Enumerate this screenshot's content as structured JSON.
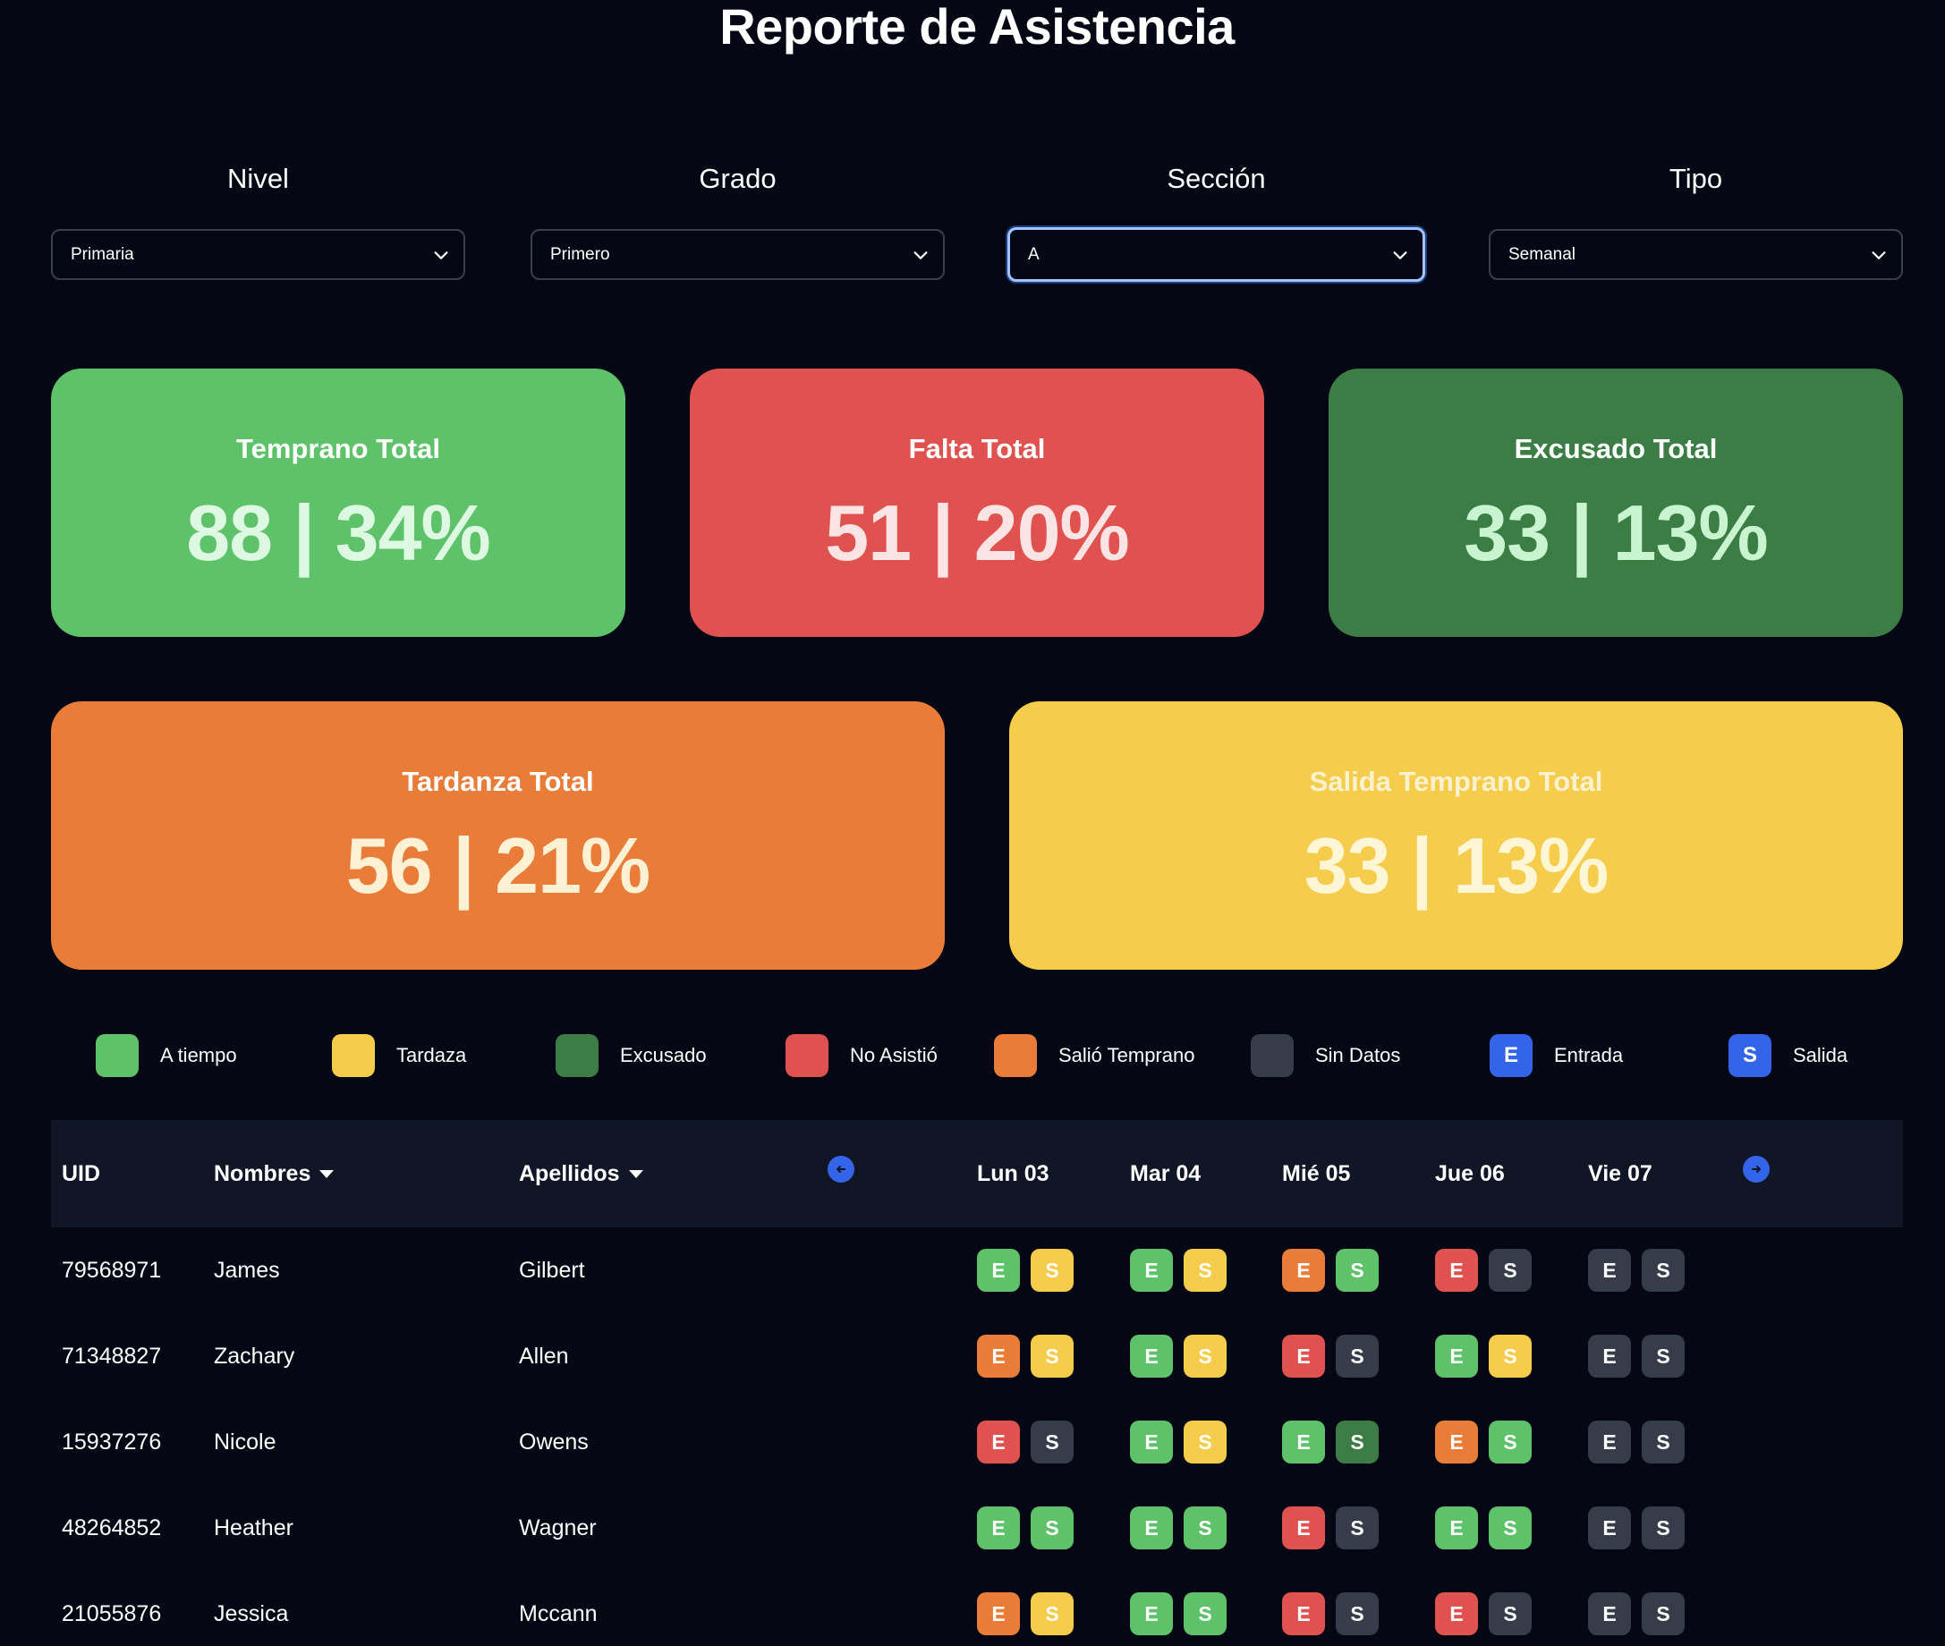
{
  "title": "Reporte de Asistencia",
  "filters": [
    {
      "label": "Nivel",
      "value": "Primaria"
    },
    {
      "label": "Grado",
      "value": "Primero"
    },
    {
      "label": "Sección",
      "value": "A"
    },
    {
      "label": "Tipo",
      "value": "Semanal"
    }
  ],
  "cards": [
    {
      "title": "Temprano Total",
      "value": "88 | 34%",
      "color": "#5ec26a"
    },
    {
      "title": "Falta Total",
      "value": "51 | 20%",
      "color": "#df524f"
    },
    {
      "title": "Excusado Total",
      "value": "33 | 13%",
      "color": "#3b7d44"
    },
    {
      "title": "Tardanza Total",
      "value": "56 | 21%",
      "color": "#e87c38"
    },
    {
      "title": "Salida Temprano Total",
      "value": "33 | 13%",
      "color": "#f5cc4b"
    }
  ],
  "legend": [
    {
      "label": "A tiempo",
      "color": "#5ec26a",
      "glyph": ""
    },
    {
      "label": "Tardaza",
      "color": "#f5cc4b",
      "glyph": ""
    },
    {
      "label": "Excusado",
      "color": "#3b7d44",
      "glyph": ""
    },
    {
      "label": "No Asistió",
      "color": "#df524f",
      "glyph": ""
    },
    {
      "label": "Salió Temprano",
      "color": "#e87c38",
      "glyph": ""
    },
    {
      "label": "Sin Datos",
      "color": "#373c4b",
      "glyph": ""
    },
    {
      "label": "Entrada",
      "color": "#3464e8",
      "glyph": "E"
    },
    {
      "label": "Salida",
      "color": "#3464e8",
      "glyph": "S"
    }
  ],
  "table": {
    "headers": {
      "uid": "UID",
      "nombres": "Nombres",
      "apellidos": "Apellidos"
    },
    "days": [
      "Lun 03",
      "Mar 04",
      "Mié 05",
      "Jue 06",
      "Vie 07"
    ],
    "status_colors": {
      "on_time": "#5ec26a",
      "late": "#f5cc4b",
      "excused": "#3b7d44",
      "absent": "#df524f",
      "left_early": "#e87c38",
      "no_data": "#373c4b"
    },
    "rows": [
      {
        "uid": "79568971",
        "nombre": "James",
        "apellido": "Gilbert",
        "days": [
          [
            "on_time",
            "late"
          ],
          [
            "on_time",
            "late"
          ],
          [
            "left_early",
            "on_time"
          ],
          [
            "absent",
            "no_data"
          ],
          [
            "no_data",
            "no_data"
          ]
        ]
      },
      {
        "uid": "71348827",
        "nombre": "Zachary",
        "apellido": "Allen",
        "days": [
          [
            "left_early",
            "late"
          ],
          [
            "on_time",
            "late"
          ],
          [
            "absent",
            "no_data"
          ],
          [
            "on_time",
            "late"
          ],
          [
            "no_data",
            "no_data"
          ]
        ]
      },
      {
        "uid": "15937276",
        "nombre": "Nicole",
        "apellido": "Owens",
        "days": [
          [
            "absent",
            "no_data"
          ],
          [
            "on_time",
            "late"
          ],
          [
            "on_time",
            "excused"
          ],
          [
            "left_early",
            "on_time"
          ],
          [
            "no_data",
            "no_data"
          ]
        ]
      },
      {
        "uid": "48264852",
        "nombre": "Heather",
        "apellido": "Wagner",
        "days": [
          [
            "on_time",
            "on_time"
          ],
          [
            "on_time",
            "on_time"
          ],
          [
            "absent",
            "no_data"
          ],
          [
            "on_time",
            "on_time"
          ],
          [
            "no_data",
            "no_data"
          ]
        ]
      },
      {
        "uid": "21055876",
        "nombre": "Jessica",
        "apellido": "Mccann",
        "days": [
          [
            "left_early",
            "late"
          ],
          [
            "on_time",
            "on_time"
          ],
          [
            "absent",
            "no_data"
          ],
          [
            "absent",
            "no_data"
          ],
          [
            "no_data",
            "no_data"
          ]
        ]
      }
    ]
  }
}
